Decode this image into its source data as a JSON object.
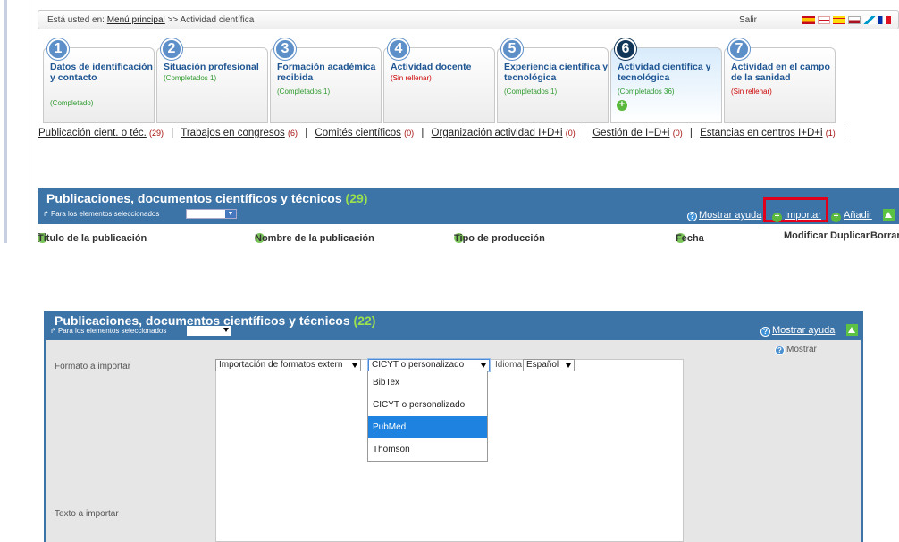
{
  "top": {
    "breadcrumb": {
      "prefix": "Está usted en:",
      "home_link": "Menú principal",
      "separator": ">>",
      "current": "Actividad científica"
    },
    "logout_label": "Salir",
    "steps": [
      {
        "num": "1",
        "title": "Datos de identificación y contacto",
        "status": "(Completado)",
        "status_color": "green"
      },
      {
        "num": "2",
        "title": "Situación profesional",
        "status": "(Completados 1)",
        "status_color": "green"
      },
      {
        "num": "3",
        "title": "Formación académica recibida",
        "status": "(Completados 1)",
        "status_color": "green"
      },
      {
        "num": "4",
        "title": "Actividad docente",
        "status": "(Sin rellenar)",
        "status_color": "red"
      },
      {
        "num": "5",
        "title": "Experiencia científica y tecnológica",
        "status": "(Completados 1)",
        "status_color": "green"
      },
      {
        "num": "6",
        "title": "Actividad científica y tecnológica",
        "status": "(Completados 36)",
        "status_color": "green"
      },
      {
        "num": "7",
        "title": "Actividad en el campo de la sanidad",
        "status": "(Sin rellenar)",
        "status_color": "red"
      }
    ],
    "subtabs": [
      {
        "label": "Publicación cient. o téc.",
        "count": "(29)"
      },
      {
        "label": "Trabajos en congresos",
        "count": "(6)"
      },
      {
        "label": "Comités científicos",
        "count": "(0)"
      },
      {
        "label": "Organización actividad I+D+i",
        "count": "(0)"
      },
      {
        "label": "Gestión de I+D+i",
        "count": "(0)"
      },
      {
        "label": "Estancias en centros I+D+i",
        "count": "(1)"
      }
    ],
    "subtab_separator": "|",
    "panel": {
      "title": "Publicaciones, documentos científicos y técnicos",
      "count": "(29)",
      "selected_label": "Para los elementos seleccionados",
      "help": "Mostrar ayuda",
      "import": "Importar",
      "add": "Añadir"
    },
    "columns": {
      "title": "Título de la publicación",
      "publication_name": "Nombre de la publicación",
      "type": "Tipo de producción",
      "date": "Fecha",
      "modify": "Modificar",
      "duplicate": "Duplicar",
      "delete": "Borrar"
    }
  },
  "bottom": {
    "panel": {
      "title": "Publicaciones, documentos científicos y técnicos",
      "count": "(22)",
      "selected_label": "Para los elementos seleccionados",
      "help": "Mostrar ayuda"
    },
    "form": {
      "format_label": "Formato a importar",
      "text_label": "Texto a importar",
      "format_select": "Importación de formatos externos",
      "format_select_visible": "Importación de formatos extern",
      "type_select": "CICYT o personalizado",
      "idioma_label": "Idioma",
      "idioma_select": "Español",
      "show_label": "Mostrar"
    },
    "dropdown_options": [
      "BibTex",
      "CICYT o personalizado",
      "PubMed",
      "Thomson"
    ],
    "dropdown_highlighted": "PubMed"
  },
  "colors": {
    "panel_blue": "#3d74a8",
    "link_blue": "#1e5592",
    "count_green": "#9be04f",
    "highlight_red": "#e0001b",
    "selection_blue": "#1e83e0"
  }
}
